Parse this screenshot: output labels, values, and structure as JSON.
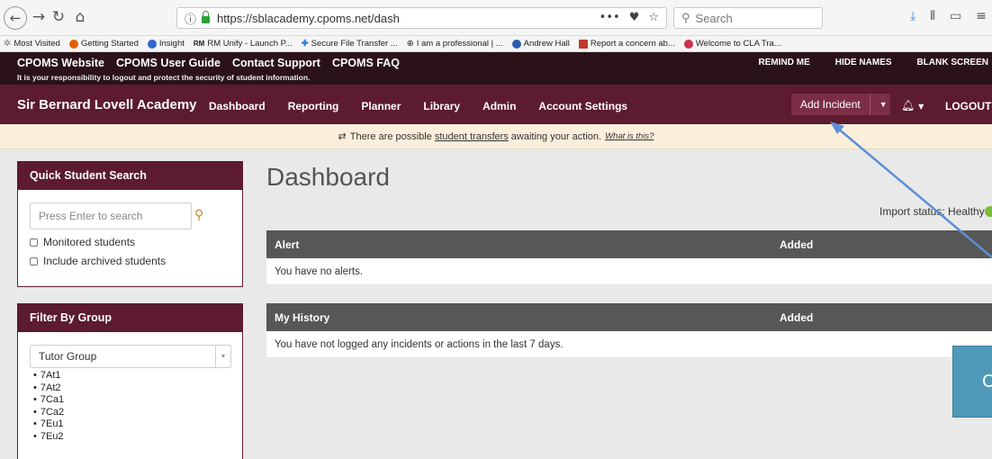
{
  "browser": {
    "url": "https://sblacademy.cpoms.net/dash",
    "search_placeholder": "Search",
    "url_actions": [
      "•••",
      "♥",
      "☆"
    ],
    "bookmarks": [
      {
        "label": "Most Visited",
        "color": "#888888"
      },
      {
        "label": "Getting Started",
        "color": "#e66000"
      },
      {
        "label": "Insight",
        "color": "#3366cc"
      },
      {
        "label": "RM Unify - Launch P...",
        "color": "#222222"
      },
      {
        "label": "Secure File Transfer ...",
        "color": "#2a7de1"
      },
      {
        "label": "I am a professional | ...",
        "color": "#555555"
      },
      {
        "label": "Andrew Hall",
        "color": "#2a5db0"
      },
      {
        "label": "Report a concern ab...",
        "color": "#c0392b"
      },
      {
        "label": "Welcome to CLA Tra...",
        "color": "#d0304a"
      }
    ]
  },
  "top_bar": {
    "links": [
      "CPOMS Website",
      "CPOMS User Guide",
      "Contact Support",
      "CPOMS FAQ"
    ],
    "notice": "It is your responsibility to logout and protect the security of student information.",
    "right_links": [
      "REMIND ME",
      "HIDE NAMES",
      "BLANK SCREEN"
    ]
  },
  "nav": {
    "brand": "Sir Bernard Lovell Academy",
    "items": [
      "Dashboard",
      "Reporting",
      "Planner",
      "Library",
      "Admin",
      "Account Settings"
    ],
    "add_incident": "Add Incident",
    "logout": "LOGOUT"
  },
  "transfer_notice": {
    "prefix": "There are possible",
    "link": "student transfers",
    "suffix": "awaiting your action.",
    "what_link": "What is this?"
  },
  "quick_search": {
    "title": "Quick Student Search",
    "placeholder": "Press Enter to search",
    "options": [
      "Monitored students",
      "Include archived students"
    ]
  },
  "filter_group": {
    "title": "Filter By Group",
    "selected": "Tutor Group",
    "groups": [
      "7At1",
      "7At2",
      "7Ca1",
      "7Ca2",
      "7Eu1",
      "7Eu2"
    ]
  },
  "dashboard": {
    "title": "Dashboard",
    "import_status": "Import status: Healthy",
    "alerts": {
      "col1": "Alert",
      "col2": "Added",
      "empty": "You have no alerts."
    },
    "history": {
      "col1": "My History",
      "col2": "Added",
      "empty": "You have not logged any incidents or actions in the last 7 days."
    }
  },
  "overlay": {
    "popup_text": "C"
  },
  "colors": {
    "brand": "#5c1b2e",
    "top_bar": "#2a1218",
    "table_head": "#575757",
    "notice_bg": "#fbefdc",
    "status_ok": "#7cba3a",
    "annotation": "#5b8fd6"
  }
}
